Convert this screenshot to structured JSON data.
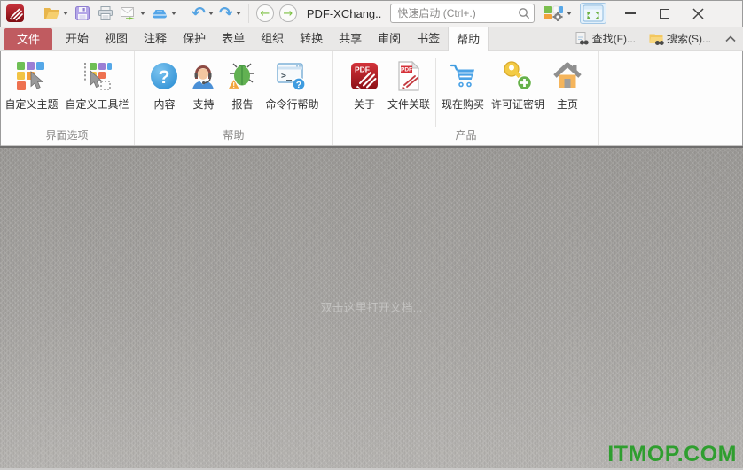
{
  "titlebar": {
    "title": "PDF-XChang..",
    "search_placeholder": "快速启动 (Ctrl+.)"
  },
  "tabs": {
    "file": "文件",
    "items": [
      "开始",
      "视图",
      "注释",
      "保护",
      "表单",
      "组织",
      "转换",
      "共享",
      "审阅",
      "书签",
      "帮助"
    ],
    "selected": "帮助",
    "find": "查找(F)...",
    "search": "搜索(S)..."
  },
  "ribbon": {
    "groups": [
      {
        "label": "界面选项",
        "buttons": [
          {
            "label": "自定义主题"
          },
          {
            "label": "自定义工具栏"
          }
        ]
      },
      {
        "label": "帮助",
        "buttons": [
          {
            "label": "内容"
          },
          {
            "label": "支持"
          },
          {
            "label": "报告"
          },
          {
            "label": "命令行帮助"
          }
        ]
      },
      {
        "label": "产品",
        "buttons": [
          {
            "label": "关于"
          },
          {
            "label": "文件关联"
          },
          {
            "label": "现在购买"
          },
          {
            "label": "许可证密钥"
          },
          {
            "label": "主页"
          }
        ]
      }
    ]
  },
  "canvas": {
    "hint": "双击这里打开文档...",
    "watermark": "ITMOP.COM"
  },
  "glyphs": {
    "undo": "↶",
    "redo": "↷",
    "back": "←",
    "forward": "→",
    "question": "?",
    "exclaim": "!",
    "pdf": "PDF",
    "prompt": ">_"
  },
  "colors": {
    "file_tab_red": "#c05b60",
    "watermark_green": "#2f9e2f",
    "titlebar_bg": "#f2f1f0",
    "tabrow_bg": "#e9e8e7",
    "ribbon_bg": "#fdfdfd",
    "canvas_gray": "#a3a19e"
  }
}
